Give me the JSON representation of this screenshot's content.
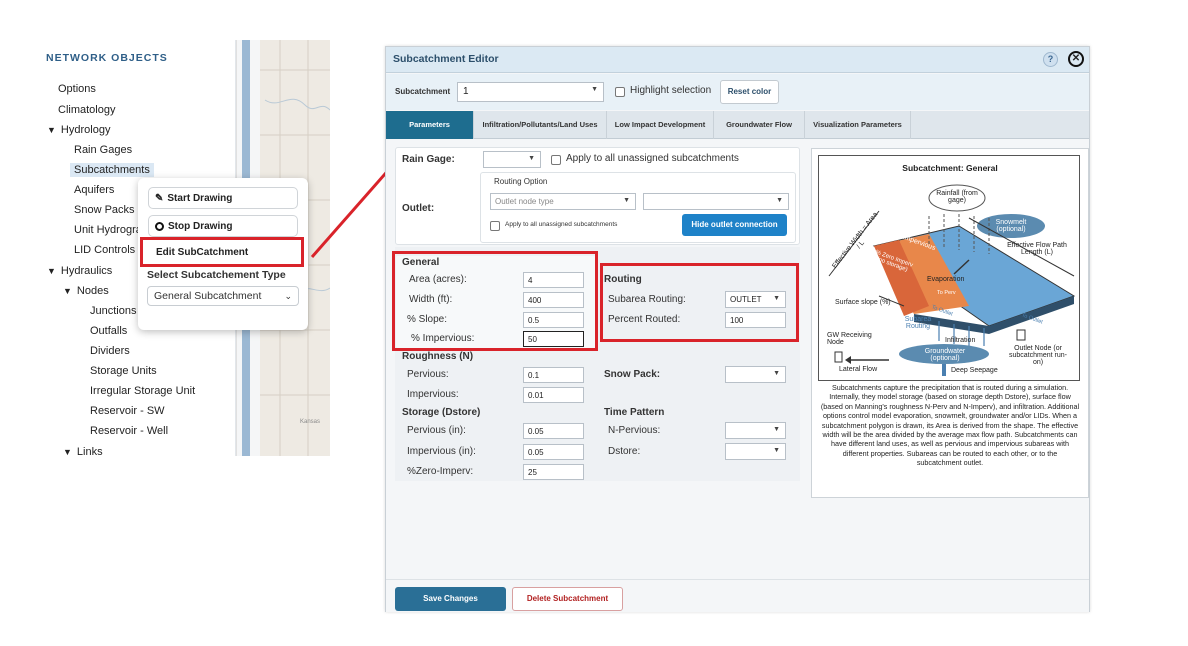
{
  "network": {
    "title": "NETWORK OBJECTS",
    "items": [
      {
        "label": "Options"
      },
      {
        "label": "Climatology"
      },
      {
        "label": "Hydrology"
      },
      {
        "label": "Rain Gages"
      },
      {
        "label": "Subcatchments"
      },
      {
        "label": "Aquifers"
      },
      {
        "label": "Snow Packs"
      },
      {
        "label": "Unit Hydrographs"
      },
      {
        "label": "LID Controls"
      },
      {
        "label": "Hydraulics"
      },
      {
        "label": "Nodes"
      },
      {
        "label": "Junctions"
      },
      {
        "label": "Outfalls"
      },
      {
        "label": "Dividers"
      },
      {
        "label": "Storage Units"
      },
      {
        "label": "Irregular Storage Unit"
      },
      {
        "label": "Reservoir - SW"
      },
      {
        "label": "Reservoir - Well"
      },
      {
        "label": "Links"
      }
    ],
    "map_label": "Kansas"
  },
  "context_menu": {
    "start_drawing": "Start Drawing",
    "stop_drawing": "Stop Drawing",
    "edit": "Edit SubCatchment",
    "type_label": "Select Subcatchement Type",
    "type_value": "General Subcatchment"
  },
  "editor": {
    "title": "Subcatchment Editor",
    "subcatchment_label": "Subcatchment",
    "subcatchment_value": "1",
    "highlight_label": "Highlight selection",
    "reset_label": "Reset color",
    "tabs": [
      {
        "label": "Parameters"
      },
      {
        "label": "Infiltration/Pollutants/Land Uses"
      },
      {
        "label": "Low Impact Development"
      },
      {
        "label": "Groundwater Flow"
      },
      {
        "label": "Visualization Parameters"
      }
    ],
    "rain_gage_label": "Rain Gage:",
    "apply_unassigned": "Apply to all unassigned subcatchments",
    "outlet_label": "Outlet:",
    "routing_option_label": "Routing Option",
    "outlet_node_type_placeholder": "Outlet node type",
    "apply_unassigned_small": "Apply to all unassigned subcatchments",
    "hide_outlet": "Hide outlet connection",
    "general": {
      "title": "General",
      "area_label": "Area (acres):",
      "area_value": "4",
      "width_label": "Width (ft):",
      "width_value": "400",
      "slope_label": "% Slope:",
      "slope_value": "0.5",
      "imperv_label": "% Impervious:",
      "imperv_value": "50"
    },
    "routing": {
      "title": "Routing",
      "subarea_label": "Subarea Routing:",
      "subarea_value": "OUTLET",
      "percent_label": "Percent Routed:",
      "percent_value": "100"
    },
    "roughness": {
      "title": "Roughness (N)",
      "pervious_label": "Pervious:",
      "pervious_value": "0.1",
      "impervious_label": "Impervious:",
      "impervious_value": "0.01"
    },
    "snow_pack_label": "Snow Pack:",
    "storage": {
      "title": "Storage (Dstore)",
      "pervious_label": "Pervious (in):",
      "pervious_value": "0.05",
      "impervious_label": "Impervious (in):",
      "impervious_value": "0.05",
      "zero_label": "%Zero-Imperv:",
      "zero_value": "25"
    },
    "time_pattern": {
      "title": "Time Pattern",
      "npervious_label": "N-Pervious:",
      "dstore_label": "Dstore:"
    },
    "save_label": "Save Changes",
    "delete_label": "Delete Subcatchment"
  },
  "info": {
    "diagram_title": "Subcatchment: General",
    "rainfall": "Rainfall (from gage)",
    "snowmelt": "Snowmelt (optional)",
    "effective_width": "Effective Width = Area / L",
    "flow_path": "Effective Flow Path Length (L)",
    "pct_impervious": "% Impervious",
    "zero_imperv": "% Zero Imperv (no storage)",
    "evaporation": "Evaporation",
    "surface_slope": "Surface slope (%)",
    "to_pervious": "To Perv",
    "to_outlet_1": "To Outlet",
    "to_outlet_2": "To Outlet",
    "subarea_routing": "Subarea Routing",
    "gw_receiving": "GW Receiving Node",
    "infiltration": "Infiltration",
    "outlet_node": "Outlet Node (or subcatchment run-on)",
    "groundwater": "Groundwater (optional)",
    "lateral_flow": "Lateral Flow",
    "deep_seepage": "Deep Seepage",
    "description": "Subcatchments capture the precipitation that is routed during a simulation. Internally, they model storage (based on storage depth Dstore), surface flow (based on Manning's roughness N-Perv and N-Imperv), and infiltration. Additional options control model evaporation, snowmelt, groundwater and/or LIDs. When a subcatchment polygon is drawn, its Area is derived from the shape. The effective width will be the area divided by the average max flow path. Subcatchments can have different land uses, as well as pervious and impervious subareas with different properties. Subareas can be routed to each other, or to the subcatchment outlet."
  },
  "colors": {
    "accent": "#1e6d8f",
    "highlight_red": "#d9232a",
    "button_blue": "#1e82c8"
  }
}
